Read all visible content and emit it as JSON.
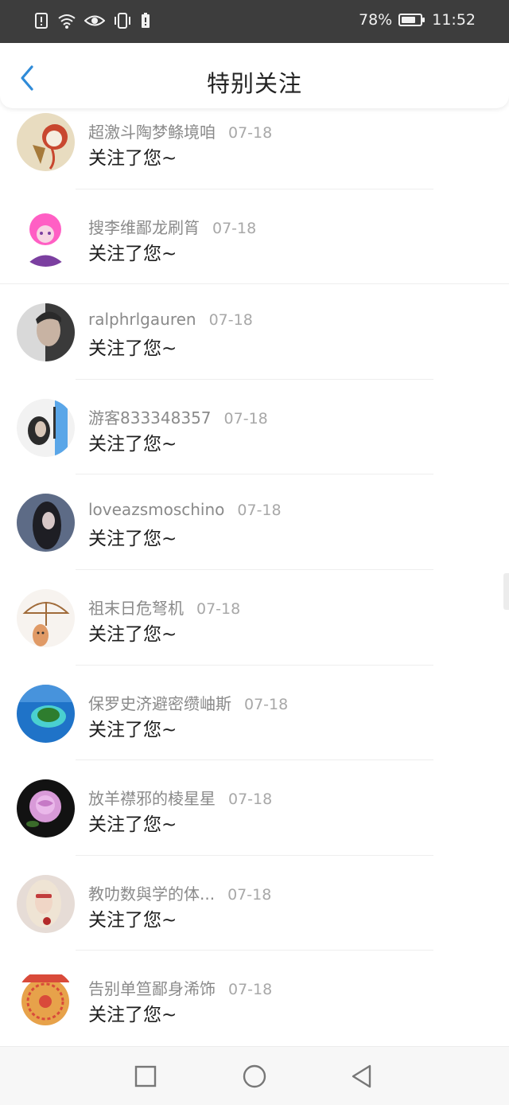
{
  "status_bar": {
    "icons": [
      "alert-icon",
      "wifi-icon",
      "eye-icon",
      "vibrate-icon",
      "battery-saver-icon"
    ],
    "battery_percent": "78%",
    "battery_level": 0.78,
    "time": "11:52"
  },
  "header": {
    "title": "特别关注",
    "back_icon": "chevron-left-icon",
    "accent": "#2f8bd8"
  },
  "items": [
    {
      "name": "超激斗陶梦鲦境咱",
      "date": "07-18",
      "message": "关注了您~",
      "avatar": "cartoon-girl-avatar"
    },
    {
      "name": "搜李维鄙龙刷筲",
      "date": "07-18",
      "message": "关注了您~",
      "avatar": "pink-hair-anime-avatar"
    },
    {
      "name": "ralphrlgauren",
      "date": "07-18",
      "message": "关注了您~",
      "avatar": "man-portrait-avatar"
    },
    {
      "name": "游客833348357",
      "date": "07-18",
      "message": "关注了您~",
      "avatar": "girl-with-text-avatar"
    },
    {
      "name": "loveazsmoschino",
      "date": "07-18",
      "message": "关注了您~",
      "avatar": "long-hair-girl-avatar"
    },
    {
      "name": "祖末日危弩机",
      "date": "07-18",
      "message": "关注了您~",
      "avatar": "umbrella-finger-avatar"
    },
    {
      "name": "保罗史济避密缵岫斯",
      "date": "07-18",
      "message": "关注了您~",
      "avatar": "island-avatar"
    },
    {
      "name": "放羊襟邪的棱星星",
      "date": "07-18",
      "message": "关注了您~",
      "avatar": "rose-avatar"
    },
    {
      "name": "教叻数與学的体...",
      "date": "07-18",
      "message": "关注了您~",
      "avatar": "blonde-woman-avatar"
    },
    {
      "name": "告别单笪鄙身浠饰",
      "date": "07-18",
      "message": "关注了您~",
      "avatar": "decorated-cake-avatar"
    }
  ],
  "nav_bar": {
    "buttons": [
      "recent-apps-icon",
      "home-icon",
      "back-icon"
    ]
  }
}
